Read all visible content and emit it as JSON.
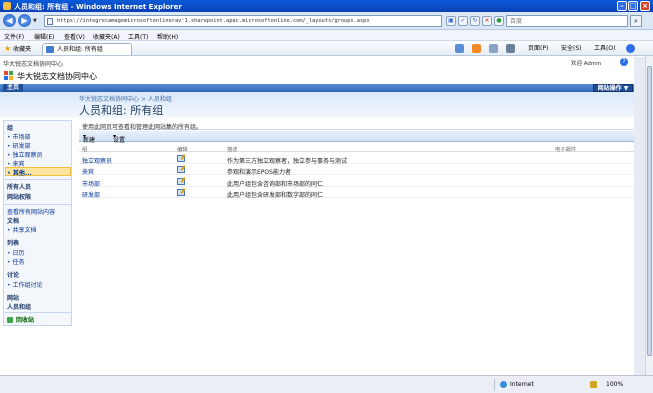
{
  "window": {
    "title": "人员和组: 所有组 - Windows Internet Explorer"
  },
  "address_bar": {
    "url": "https://integrecamagemicrosoftonlinerav'1.sharepoint.apac.microsoftonline.com/_layouts/groups.aspx",
    "search_placeholder": "百度"
  },
  "menu": [
    "文件(F)",
    "编辑(E)",
    "查看(V)",
    "收藏夹(A)",
    "工具(T)",
    "帮助(H)"
  ],
  "favorites_bar": {
    "favorites_label": "收藏夹",
    "tab_label": "人员和组: 所有组",
    "commands": [
      "页面(P)",
      "安全(S)",
      "工具(O)"
    ]
  },
  "sharepoint": {
    "site_crumb": "华大锐志文档协同中心",
    "welcome": "欢迎 Admin",
    "site_name": "华大锐志文档协同中心",
    "home_tab": "主页",
    "site_actions": "网站操作",
    "breadcrumb": "华大锐志文档协同中心 > 人员和组",
    "page_title": "人员和组: 所有组"
  },
  "left_nav": {
    "groups_heading": "组",
    "groups": [
      "市场部",
      "研发部",
      "独立观察员",
      "来宾",
      "其他..."
    ],
    "all_people": "所有人员",
    "site_permissions": "网站权限",
    "view_all": "查看所有网站内容",
    "documents_heading": "文档",
    "documents": [
      "共享文档"
    ],
    "lists_heading": "列表",
    "lists": [
      "日历",
      "任务"
    ],
    "discussions_heading": "讨论",
    "discussions": [
      "工作组讨论"
    ],
    "sites_heading": "网站",
    "people_groups_heading": "人员和组",
    "recycle_bin": "回收站"
  },
  "main": {
    "description": "使用此网页可查看和管理此网站集的所有组。",
    "toolbar": {
      "new": "新建",
      "settings": "设置"
    },
    "columns": {
      "group": "组",
      "edit": "编辑",
      "about": "描述",
      "email": "电子邮件"
    },
    "rows": [
      {
        "name": "独立观察员",
        "about": "作为第三方独立观察者，独立参与事务与测试"
      },
      {
        "name": "来宾",
        "about": "参观和演示EPOS能力者"
      },
      {
        "name": "市场部",
        "about": "此用户组包含咨询部和市场部的同仁"
      },
      {
        "name": "研发部",
        "about": "此用户组包含研发部和数字部的同仁"
      }
    ]
  },
  "status_bar": {
    "zone": "Internet",
    "zoom": "100%"
  }
}
